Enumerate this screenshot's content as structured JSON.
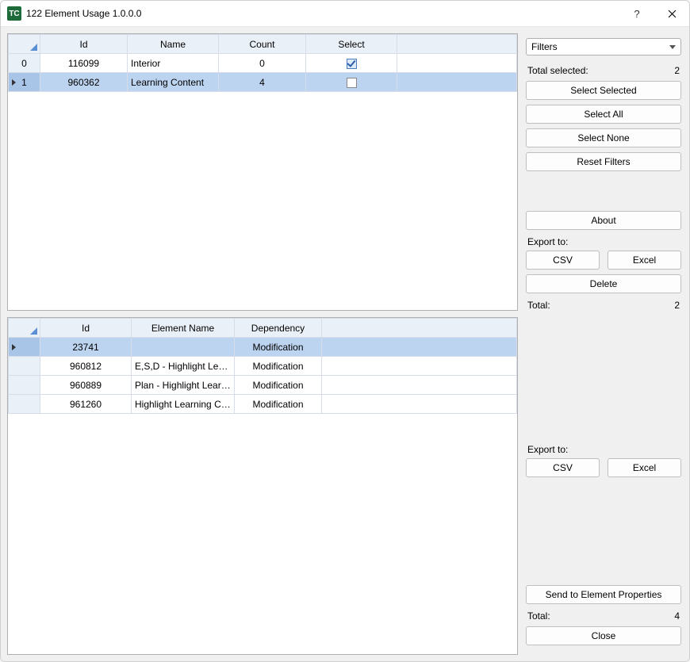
{
  "window": {
    "title": "122 Element Usage 1.0.0.0",
    "icon_text": "TC"
  },
  "top_table": {
    "headers": {
      "id": "Id",
      "name": "Name",
      "count": "Count",
      "select": "Select"
    },
    "rows": [
      {
        "idx": "0",
        "id": "116099",
        "name": "Interior",
        "count": "0",
        "selected": true,
        "active": false
      },
      {
        "idx": "1",
        "id": "960362",
        "name": "Learning Content",
        "count": "4",
        "selected": false,
        "active": true
      }
    ]
  },
  "bottom_table": {
    "headers": {
      "id": "Id",
      "name": "Element Name",
      "dep": "Dependency"
    },
    "rows": [
      {
        "id": "23741",
        "name": "",
        "dep": "Modification",
        "active": true
      },
      {
        "id": "960812",
        "name": "E,S,D - Highlight Lear...",
        "dep": "Modification",
        "active": false
      },
      {
        "id": "960889",
        "name": "Plan - Highlight Learni...",
        "dep": "Modification",
        "active": false
      },
      {
        "id": "961260",
        "name": "Highlight Learning Co...",
        "dep": "Modification",
        "active": false
      }
    ]
  },
  "sidebar": {
    "filters_label": "Filters",
    "total_selected_label": "Total selected:",
    "total_selected_value": "2",
    "buttons": {
      "select_selected": "Select Selected",
      "select_all": "Select All",
      "select_none": "Select None",
      "reset_filters": "Reset Filters",
      "about": "About",
      "csv": "CSV",
      "excel": "Excel",
      "delete": "Delete",
      "send_props": "Send to Element Properties",
      "close": "Close"
    },
    "export_label": "Export to:",
    "total1_label": "Total:",
    "total1_value": "2",
    "total2_label": "Total:",
    "total2_value": "4"
  }
}
